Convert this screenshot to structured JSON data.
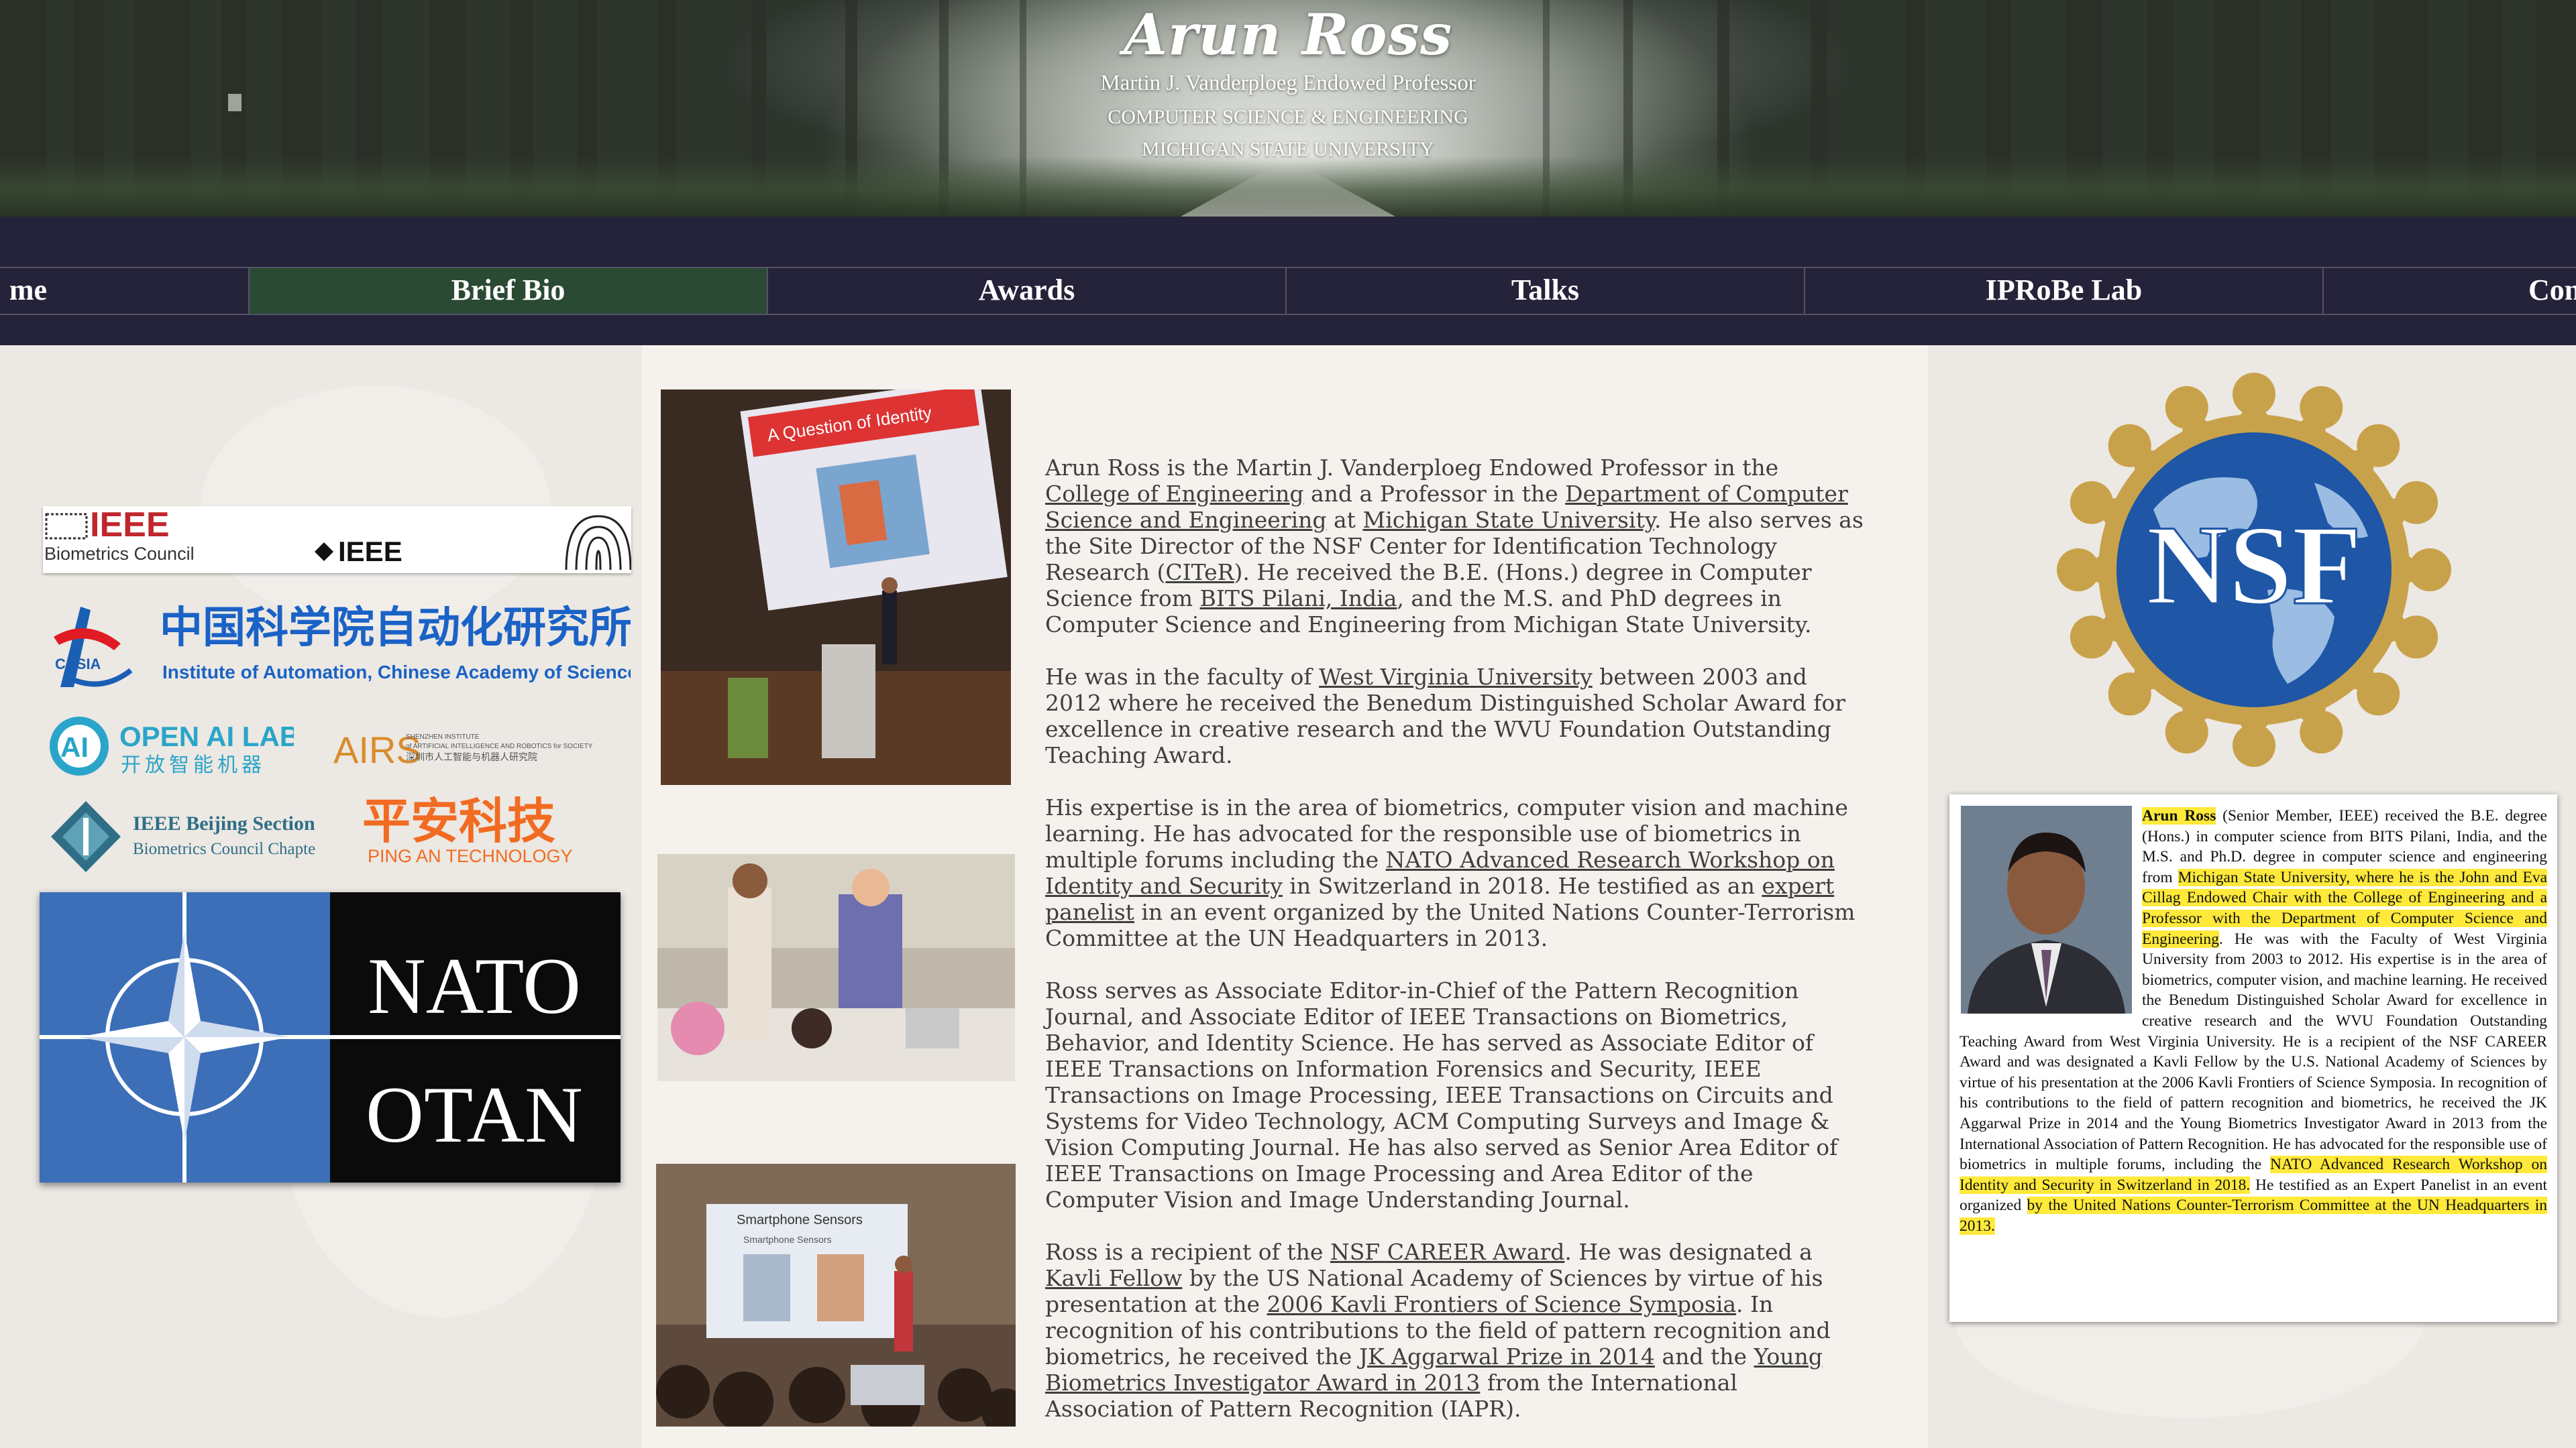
{
  "header": {
    "title": "Arun Ross",
    "subtitle_line1": "Martin J. Vanderploeg Endowed Professor",
    "subtitle_line2": "COMPUTER SCIENCE & ENGINEERING",
    "subtitle_line3": "MICHIGAN STATE UNIVERSITY"
  },
  "nav": {
    "items": [
      {
        "label": "Home",
        "visible_text": "me",
        "active": false
      },
      {
        "label": "Brief Bio",
        "active": true
      },
      {
        "label": "Awards",
        "active": false
      },
      {
        "label": "Talks",
        "active": false
      },
      {
        "label": "IPRoBe Lab",
        "active": false
      },
      {
        "label": "Contact",
        "visible_text": "Con",
        "active": false
      }
    ],
    "active_color": "#2b4a33",
    "bar_color": "#252339"
  },
  "logos": {
    "ieee_biometrics": {
      "left_text": "IEEE",
      "left_sub": "Biometrics Council",
      "right_text": "IEEE"
    },
    "casia": {
      "cn": "中国科学院自动化研究所",
      "en": "Institute of Automation, Chinese Academy of Sciences",
      "mark": "CASIA"
    },
    "openai_lab": {
      "title": "OPEN AI LAB",
      "cn": "开放智能机器",
      "mark": "AI"
    },
    "airs": {
      "mark": "AIRS",
      "line1": "SHENZHEN INSTITUTE",
      "line2": "of ARTIFICIAL INTELLIGENCE AND ROBOTICS for SOCIETY",
      "line3": "深圳市人工智能与机器人研究院"
    },
    "ieee_beijing": {
      "line1": "IEEE Beijing Section",
      "line2": "Biometrics Council Chapter"
    },
    "pingan": {
      "cn": "平安科技",
      "en": "PING AN TECHNOLOGY"
    },
    "nato": {
      "line1": "NATO",
      "line2": "OTAN"
    }
  },
  "photos": {
    "slide1_title": "A Question of Identity",
    "slide3_title": "Smartphone Sensors",
    "slide3_sub": "Smartphone Sensors"
  },
  "bio": {
    "p1": {
      "t1": "Arun Ross is the Martin J. Vanderploeg Endowed Professor in the ",
      "l1": "College of Engineering",
      "t2": " and a Professor in the ",
      "l2": "Department of Computer Science and Engineering",
      "t3": " at ",
      "l3": "Michigan State University",
      "t4": ". He also serves as the Site Director of the NSF Center for Identification Technology Research (",
      "l4": "CITeR",
      "t5": "). He received the B.E. (Hons.) degree in Computer Science from ",
      "l5": "BITS Pilani, India",
      "t6": ", and the M.S. and PhD degrees in Computer Science and Engineering from Michigan State University."
    },
    "p2": {
      "t1": "He was in the faculty of ",
      "l1": "West Virginia University",
      "t2": " between 2003 and 2012 where he received the Benedum Distinguished Scholar Award for excellence in creative research and the WVU Foundation Outstanding Teaching Award."
    },
    "p3": {
      "t1": "His expertise is in the area of biometrics, computer vision and machine learning. He has advocated for the responsible use of biometrics in multiple forums including the ",
      "l1": "NATO Advanced Research Workshop on Identity and Security",
      "t2": " in Switzerland in 2018. He testified as an ",
      "l2": "expert panelist",
      "t3": " in an event organized by the United Nations Counter-Terrorism Committee at the UN Headquarters in 2013."
    },
    "p4": {
      "t1": "Ross serves as Associate Editor-in-Chief of the Pattern Recognition Journal, and Associate Editor of IEEE Transactions on Biometrics, Behavior, and Identity Science. He has served as Associate Editor of IEEE Transactions on Information Forensics and Security, IEEE Transactions on Image Processing, IEEE Transactions on Circuits and Systems for Video Technology, ACM Computing Surveys and Image & Vision Computing Journal. He has also served as Senior Area Editor of IEEE Transactions on Image Processing and Area Editor of the Computer Vision and Image Understanding Journal."
    },
    "p5": {
      "t1": "Ross is a recipient of the ",
      "l1": "NSF CAREER Award",
      "t2": ". He was designated a ",
      "l2": "Kavli Fellow",
      "t3": " by the US National Academy of Sciences by virtue of his presentation at the ",
      "l3": "2006 Kavli Frontiers of Science Symposia",
      "t4": ". In recognition of his contributions to the field of pattern recognition and biometrics, he received the ",
      "l4": "JK Aggarwal Prize in 2014",
      "t5": " and the ",
      "l5": "Young Biometrics Investigator Award in 2013",
      "t6": " from the International Association of Pattern Recognition (IAPR)."
    }
  },
  "nsf": {
    "text": "NSF"
  },
  "bio_card": {
    "name": "Arun Ross",
    "s1": " (Senior Member, IEEE) received the B.E. degree (Hons.) in computer science from BITS Pilani, India, and the M.S. and Ph.D. degree in computer science and engineering from ",
    "h1": "Michigan State University, where he is the John and Eva Cillag Endowed Chair with the College of Engineering and a Professor with the Department of Computer Science and Engineering",
    "s2": ". He was with the Faculty of West Virginia University from 2003 to 2012. His expertise is in the area of biometrics, computer vision, and machine learning. He received the Benedum Distinguished Scholar Award for excellence in creative research and the WVU Foundation Outstanding Teaching Award from West Virginia University. He is a recipient of the NSF CAREER Award and was designated a Kavli Fellow by the U.S. National Academy of Sciences by virtue of his presentation at the 2006 Kavli Frontiers of Science Symposia. In recognition of his contributions to the field of pattern recognition and biometrics, he received the JK Aggarwal Prize in 2014 and the Young Biometrics Investigator Award in 2013 from the International Association of Pattern Recognition. He has advocated for the responsible use of biometrics in multiple forums, including the ",
    "h2": "NATO Advanced Research Workshop on Identity and Security in Switzerland in 2018.",
    "s3": " He testified as an Expert Panelist in an event organized ",
    "h3": "by the United Nations Counter-Terrorism Committee at the UN Headquarters in 2013."
  }
}
